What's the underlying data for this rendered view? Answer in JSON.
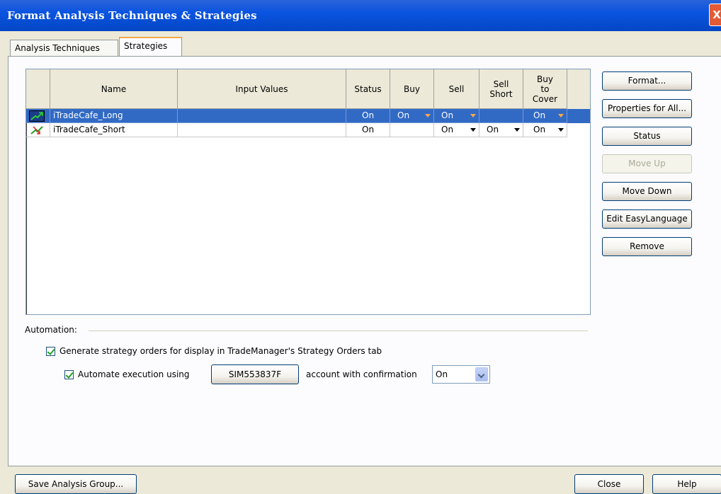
{
  "window": {
    "title": "Format Analysis Techniques & Strategies",
    "close_glyph": "X"
  },
  "tabs": [
    {
      "label": "Analysis Techniques",
      "active": false
    },
    {
      "label": "Strategies",
      "active": true
    }
  ],
  "grid": {
    "headers": [
      "",
      "Name",
      "Input Values",
      "Status",
      "Buy",
      "Sell",
      "Sell Short",
      "Buy to Cover"
    ],
    "rows": [
      {
        "icon": "strategy-long-icon",
        "name": "iTradeCafe_Long",
        "input_values": "",
        "status": "On",
        "buy": "On",
        "sell": "On",
        "sell_short": "",
        "buy_to_cover": "On",
        "selected": true
      },
      {
        "icon": "strategy-short-icon",
        "name": "iTradeCafe_Short",
        "input_values": "",
        "status": "On",
        "buy": "",
        "sell": "On",
        "sell_short": "On",
        "buy_to_cover": "On",
        "selected": false
      }
    ]
  },
  "side_buttons": {
    "format": "Format...",
    "properties_all": "Properties for All...",
    "status": "Status",
    "move_up": "Move Up",
    "move_down": "Move Down",
    "edit_easylanguage": "Edit EasyLanguage",
    "remove": "Remove"
  },
  "automation": {
    "label": "Automation:",
    "generate_orders_label": "Generate strategy orders for display in TradeManager's Strategy Orders tab",
    "generate_orders_checked": true,
    "automate_label": "Automate execution using",
    "automate_checked": true,
    "account_button": "SIM553837F",
    "confirmation_label": "account with confirmation",
    "confirmation_value": "On"
  },
  "footer": {
    "save_group": "Save Analysis Group...",
    "close": "Close",
    "help": "Help"
  },
  "colors": {
    "title_bar": "#0a54e0",
    "selection": "#316ac5",
    "dropdown_accent": "#f5a74a"
  }
}
